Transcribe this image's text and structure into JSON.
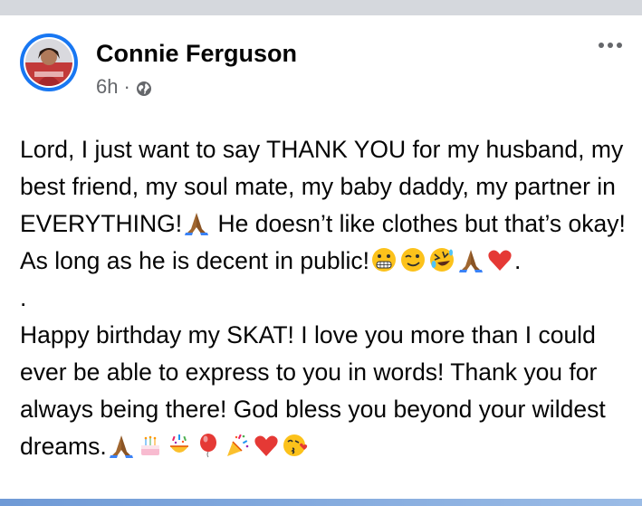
{
  "post": {
    "author": "Connie Ferguson",
    "time": "6h",
    "separator": "·",
    "privacy_icon": "globe-icon",
    "menu_icon": "more-options-icon",
    "paragraph1_text": "Lord, I just want to say THANK YOU for my husband, my best friend, my soul mate, my baby daddy, my partner in EVERYTHING!",
    "paragraph1_emoji1": "folded-hands",
    "paragraph1_text2": " He doesn’t like clothes but that’s okay! As long as he is decent in public!",
    "paragraph1_emojis": [
      "grimacing-face",
      "winking-face",
      "rolling-on-floor-laughing",
      "folded-hands",
      "red-heart"
    ],
    "paragraph1_end": ".",
    "separator_line": ".",
    "paragraph2_text": "Happy birthday my SKAT! I love you more than I could ever be able to express to you in words! Thank you for always being there! God bless you beyond your wildest dreams.",
    "paragraph2_emojis": [
      "folded-hands",
      "birthday-cake",
      "confetti-ball",
      "balloon",
      "party-popper",
      "red-heart",
      "face-blowing-kiss"
    ]
  },
  "colors": {
    "accent": "#1877f2",
    "text": "#050505",
    "secondary_text": "#65676b"
  }
}
